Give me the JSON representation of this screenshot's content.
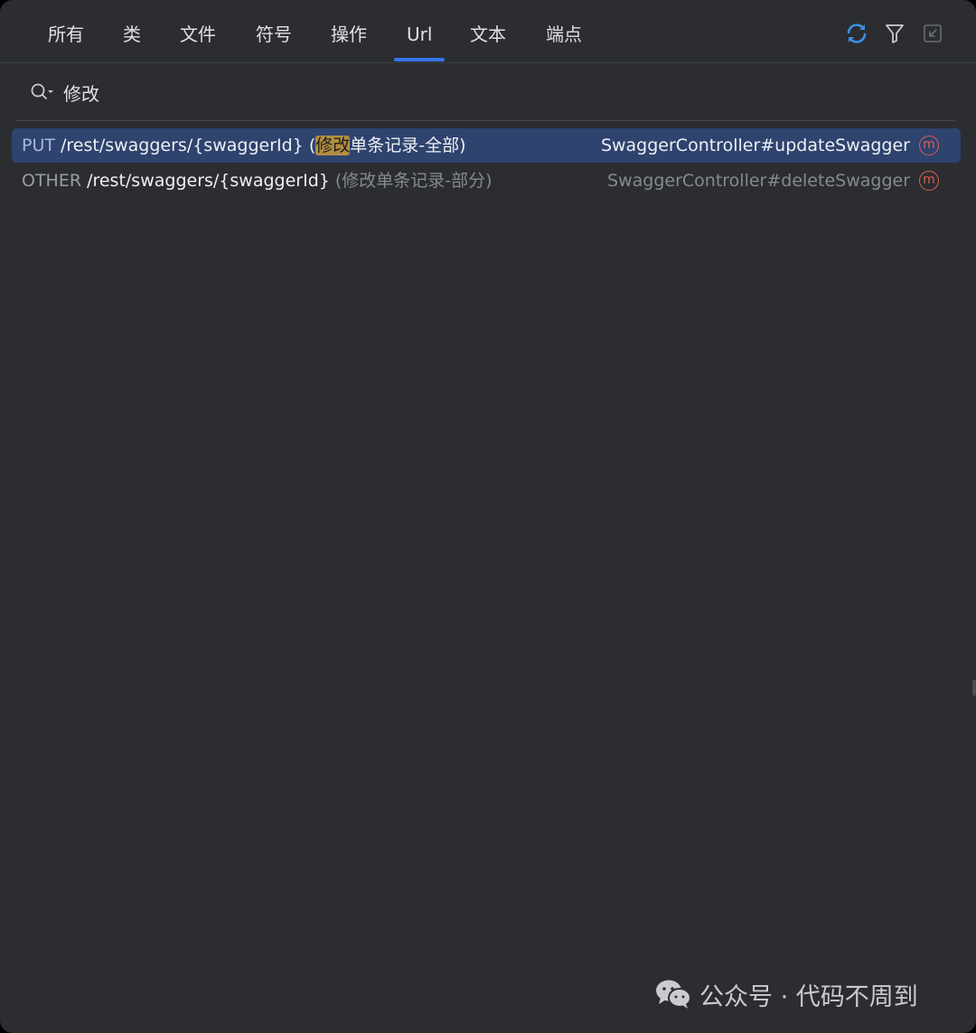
{
  "tabs": [
    {
      "label": "所有"
    },
    {
      "label": "类"
    },
    {
      "label": "文件"
    },
    {
      "label": "符号"
    },
    {
      "label": "操作"
    },
    {
      "label": "Url",
      "active": true
    },
    {
      "label": "文本"
    },
    {
      "label": "端点"
    }
  ],
  "toolbar": {
    "icons": [
      "refresh-icon",
      "filter-icon",
      "collapse-window-icon"
    ],
    "refresh_color": "#3d8fe0"
  },
  "search": {
    "value": "修改",
    "icon": "search-icon"
  },
  "results": [
    {
      "method": "PUT",
      "path": "/rest/swaggers/{swaggerId}",
      "desc_open": " (",
      "desc_highlight": "修改",
      "desc_rest": "单条记录-全部)",
      "target": "SwaggerController#updateSwagger",
      "badge": "m",
      "selected": true
    },
    {
      "method": "OTHER",
      "path": "/rest/swaggers/{swaggerId}",
      "desc": " (修改单条记录-部分)",
      "target": "SwaggerController#deleteSwagger",
      "badge": "m",
      "selected": false
    }
  ],
  "watermark": {
    "text": "公众号 · 代码不周到"
  },
  "colors": {
    "background": "#2b2d30",
    "selection": "#2e436e",
    "highlight": "#b18e40",
    "accent": "#3574f0",
    "method_badge": "#e05d54"
  }
}
